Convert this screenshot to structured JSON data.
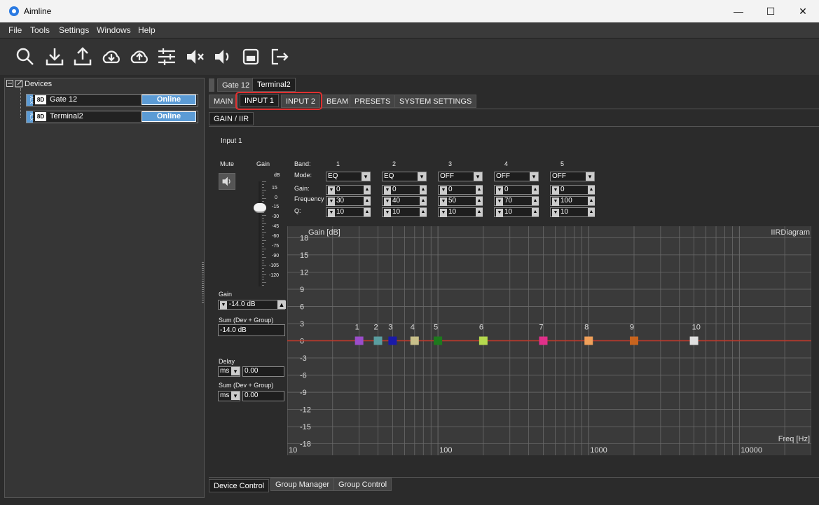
{
  "window": {
    "title": "Aimline",
    "controls": [
      "—",
      "☐",
      "✕"
    ]
  },
  "menu": [
    "File",
    "Tools",
    "Settings",
    "Windows",
    "Help"
  ],
  "toolbar": [
    "search-icon",
    "download-icon",
    "upload-icon",
    "cloud-download-icon",
    "cloud-upload-icon",
    "sliders-icon",
    "mute-icon",
    "volume-icon",
    "save-icon",
    "exit-icon"
  ],
  "devices": {
    "root": "Devices",
    "items": [
      {
        "badge": "8D",
        "tag": "ALX",
        "name": "Gate 12",
        "status": "Online"
      },
      {
        "badge": "8D",
        "tag": "ALX",
        "name": "Terminal2",
        "status": "Online"
      }
    ]
  },
  "device_tabs": [
    "Gate 12",
    "Terminal2"
  ],
  "main_tabs": [
    "MAIN",
    "INPUT 1",
    "INPUT 2",
    "BEAM",
    "PRESETS",
    "SYSTEM SETTINGS"
  ],
  "sub_tabs": [
    "GAIN / IIR"
  ],
  "section_title": "Input 1",
  "mute": {
    "label": "Mute"
  },
  "gain": {
    "label": "Gain",
    "unit": "dB",
    "scale": [
      "15",
      "0",
      "-15",
      "-30",
      "-45",
      "-60",
      "-75",
      "-90",
      "-105",
      "-120"
    ],
    "value_label": "Gain",
    "value": "-14.0 dB",
    "sum_label": "Sum (Dev + Group)",
    "sum_value": "-14.0 dB",
    "slider_db": -14.0
  },
  "delay": {
    "label": "Delay",
    "unit": "ms",
    "value": "0.00",
    "sum_label": "Sum (Dev + Group)",
    "sum_unit": "ms",
    "sum_value": "0.00"
  },
  "bands": {
    "row_labels": {
      "band": "Band:",
      "mode": "Mode:",
      "gain": "Gain:",
      "freq": "Frequency",
      "q": "Q:"
    },
    "items": [
      {
        "band": "1",
        "mode": "EQ",
        "gain": "0",
        "freq": "30",
        "q": "10"
      },
      {
        "band": "2",
        "mode": "EQ",
        "gain": "0",
        "freq": "40",
        "q": "10"
      },
      {
        "band": "3",
        "mode": "OFF",
        "gain": "0",
        "freq": "50",
        "q": "10"
      },
      {
        "band": "4",
        "mode": "OFF",
        "gain": "0",
        "freq": "70",
        "q": "10"
      },
      {
        "band": "5",
        "mode": "OFF",
        "gain": "0",
        "freq": "100",
        "q": "10"
      }
    ]
  },
  "chart_data": {
    "type": "line",
    "title": "IIRDiagram",
    "ylabel": "Gain [dB]",
    "xlabel": "Freq [Hz]",
    "x_scale": "log",
    "xlim": [
      10,
      30000
    ],
    "ylim": [
      -20,
      20
    ],
    "x_ticks": [
      "10",
      "100",
      "1000",
      "10000"
    ],
    "y_ticks": [
      "18",
      "15",
      "12",
      "9",
      "6",
      "3",
      "0",
      "-3",
      "-6",
      "-9",
      "-12",
      "-15",
      "-18"
    ],
    "response": {
      "x": [
        10,
        30000
      ],
      "y": [
        0,
        0
      ],
      "color": "#c0392b"
    },
    "markers": [
      {
        "label": "1",
        "freq": 30,
        "gain": 0,
        "color": "#9b4dca"
      },
      {
        "label": "2",
        "freq": 40,
        "gain": 0,
        "color": "#5a9ea0"
      },
      {
        "label": "3",
        "freq": 50,
        "gain": 0,
        "color": "#1a1aa8"
      },
      {
        "label": "4",
        "freq": 70,
        "gain": 0,
        "color": "#c9c08a"
      },
      {
        "label": "5",
        "freq": 100,
        "gain": 0,
        "color": "#1e7a1e"
      },
      {
        "label": "6",
        "freq": 200,
        "gain": 0,
        "color": "#b5d94e"
      },
      {
        "label": "7",
        "freq": 500,
        "gain": 0,
        "color": "#e0308a"
      },
      {
        "label": "8",
        "freq": 1000,
        "gain": 0,
        "color": "#f0a05a"
      },
      {
        "label": "9",
        "freq": 2000,
        "gain": 0,
        "color": "#c8641e"
      },
      {
        "label": "10",
        "freq": 5000,
        "gain": 0,
        "color": "#e0e0e0"
      }
    ],
    "grid": true
  },
  "bottom_tabs": [
    "Device Control",
    "Group Manager",
    "Group Control"
  ]
}
